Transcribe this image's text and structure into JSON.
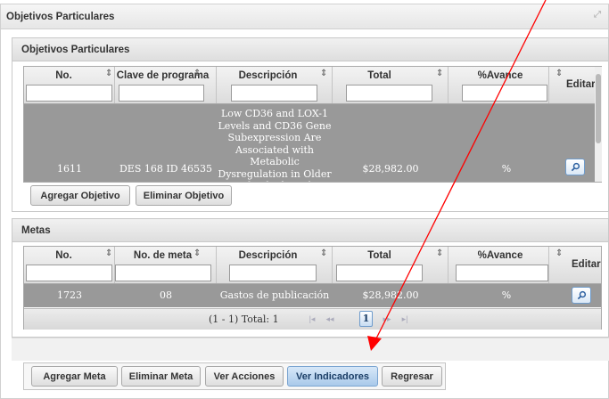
{
  "outer_panel": {
    "title": "Objetivos Particulares"
  },
  "objetivos": {
    "title": "Objetivos Particulares",
    "columns": [
      {
        "label": "No."
      },
      {
        "label": "Clave de programa"
      },
      {
        "label": "Descripción"
      },
      {
        "label": "Total"
      },
      {
        "label": "%Avance"
      }
    ],
    "editar_label": "Editar",
    "row": {
      "no": "1611",
      "clave": "DES 168 ID 46535",
      "descripcion": "Low CD36 and LOX-1 Levels and CD36 Gene Subexpression Are Associated with Metabolic Dysregulation in Older Individuals with",
      "total": "$28,982.00",
      "avance": "%"
    },
    "buttons": {
      "agregar": "Agregar Objetivo",
      "eliminar": "Eliminar Objetivo"
    }
  },
  "metas": {
    "title": "Metas",
    "columns": [
      {
        "label": "No."
      },
      {
        "label": "No. de meta"
      },
      {
        "label": "Descripción"
      },
      {
        "label": "Total"
      },
      {
        "label": "%Avance"
      }
    ],
    "editar_label": "Editar",
    "row": {
      "no": "1723",
      "meta": "08",
      "descripcion": "Gastos de publicación",
      "total": "$28,982.00",
      "avance": "%"
    },
    "pager": {
      "summary": "(1 - 1) Total: 1",
      "current_page": "1"
    }
  },
  "bottom_buttons": {
    "agregar_meta": "Agregar Meta",
    "eliminar_meta": "Eliminar Meta",
    "ver_acciones": "Ver Acciones",
    "ver_indicadores": "Ver Indicadores",
    "regresar": "Regresar"
  },
  "annotation": {
    "color": "#ff0000"
  }
}
